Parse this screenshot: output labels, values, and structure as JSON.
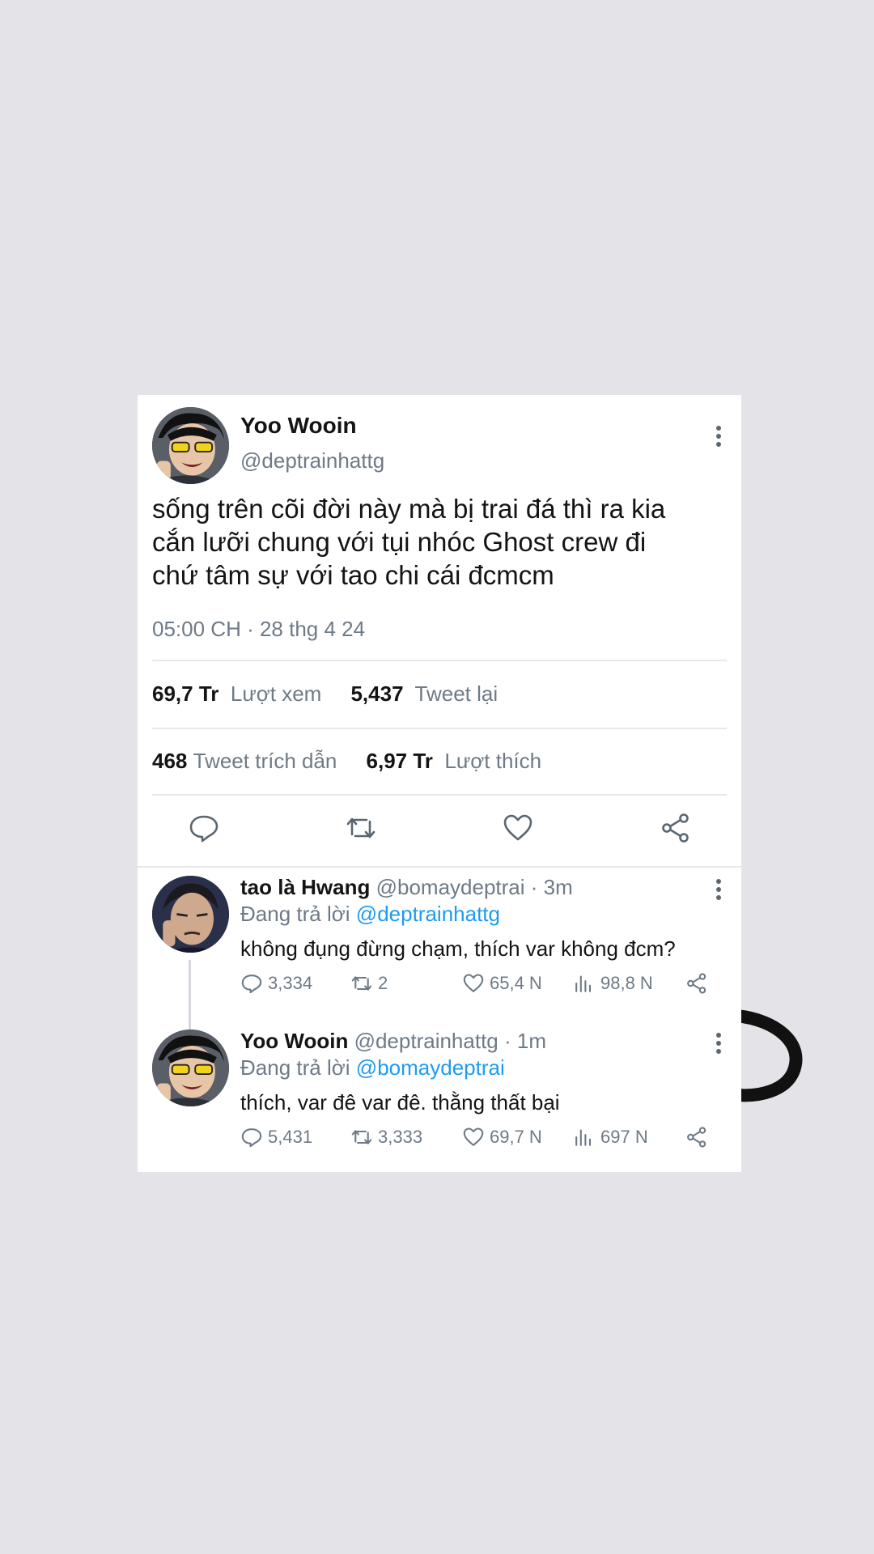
{
  "tweet": {
    "author_name": "Yoo Wooin",
    "author_handle": "@deptrainhattg",
    "text_lines": [
      "sống trên cõi đời này mà bị trai đá thì ra kia",
      "cắn lưỡi chung với tụi nhóc Ghost crew đi",
      "chứ tâm sự với tao chi cái đcmcm"
    ],
    "timestamp": "05:00 CH · 28 thg 4 24",
    "views_count": "69,7 Tr",
    "views_label": "Lượt xem",
    "retweets_count": "5,437",
    "retweets_label": "Tweet lại",
    "quotes_count": "468",
    "quotes_label": "Tweet trích dẫn",
    "likes_count": "6,97 Tr",
    "likes_label": "Lượt thích"
  },
  "replies": [
    {
      "name": "tao là Hwang",
      "handle_time": "@bomaydeptrai · 3m",
      "replying_label": "Đang trả lời",
      "replying_to": "@deptrainhattg",
      "text": "không đụng đừng chạm, thích var không đcm?",
      "comments": "3,334",
      "retweets": "2",
      "likes": "65,4 N",
      "views": "98,8 N"
    },
    {
      "name": "Yoo Wooin",
      "handle_time": "@deptrainhattg · 1m",
      "replying_label": "Đang trả lời",
      "replying_to": "@bomaydeptrai",
      "text": "thích, var đê var đê. thằng thất bại",
      "comments": "5,431",
      "retweets": "3,333",
      "likes": "69,7 N",
      "views": "697 N"
    }
  ],
  "colors": {
    "background": "#e4e4e8",
    "text": "#141414",
    "secondary": "#6e7a86",
    "link": "#1d9bf0"
  },
  "icons": [
    "more-icon",
    "reply-icon",
    "retweet-icon",
    "like-icon",
    "share-icon",
    "views-icon"
  ]
}
